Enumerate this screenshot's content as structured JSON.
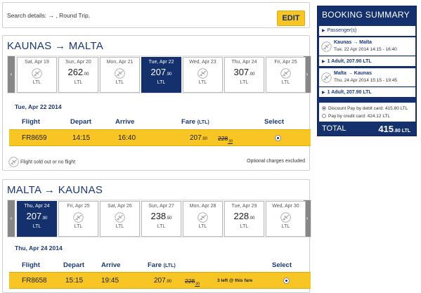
{
  "search": {
    "label": "Search details: → , Round Trip,",
    "edit": "EDIT"
  },
  "outbound": {
    "title": "KAUNAS → MALTA",
    "days": [
      {
        "date": "Sat, Apr 19",
        "price": "",
        "dec": "",
        "currency": "LTL",
        "available": false
      },
      {
        "date": "Sun, Apr 20",
        "price": "262",
        "dec": ".00",
        "currency": "LTL",
        "available": true
      },
      {
        "date": "Mon, Apr 21",
        "price": "",
        "dec": "",
        "currency": "LTL",
        "available": false
      },
      {
        "date": "Tue, Apr 22",
        "price": "207",
        "dec": ".90",
        "currency": "LTL",
        "available": true,
        "selected": true
      },
      {
        "date": "Wed, Apr 23",
        "price": "",
        "dec": "",
        "currency": "LTL",
        "available": false
      },
      {
        "date": "Thu, Apr 24",
        "price": "307",
        "dec": ".00",
        "currency": "LTL",
        "available": true
      },
      {
        "date": "Fri, Apr 25",
        "price": "",
        "dec": "",
        "currency": "LTL",
        "available": false
      }
    ],
    "selected_date": "Tue, Apr 22 2014",
    "headers": {
      "flight": "Flight",
      "depart": "Depart",
      "arrive": "Arrive",
      "fare": "Fare",
      "fare_unit": "(LTL)",
      "select": "Select"
    },
    "row": {
      "flight": "FR8659",
      "depart": "14:15",
      "arrive": "16:40",
      "fare": "207",
      "fare_dec": ".90",
      "old": "228",
      "old_dec": ".00"
    }
  },
  "legend": {
    "soldout": "Flight sold out or no flight",
    "optional": "Optional charges excluded"
  },
  "return": {
    "title": "MALTA → KAUNAS",
    "days": [
      {
        "date": "Thu, Apr 24",
        "price": "207",
        "dec": ".90",
        "currency": "LTL",
        "available": true,
        "selected": true
      },
      {
        "date": "Fri, Apr 25",
        "price": "",
        "dec": "",
        "currency": "LTL",
        "available": false
      },
      {
        "date": "Sat, Apr 26",
        "price": "",
        "dec": "",
        "currency": "LTL",
        "available": false
      },
      {
        "date": "Sun, Apr 27",
        "price": "238",
        "dec": ".50",
        "currency": "LTL",
        "available": true
      },
      {
        "date": "Mon, Apr 28",
        "price": "",
        "dec": "",
        "currency": "LTL",
        "available": false
      },
      {
        "date": "Tue, Apr 29",
        "price": "228",
        "dec": ".00",
        "currency": "LTL",
        "available": true
      },
      {
        "date": "Wed, Apr 30",
        "price": "",
        "dec": "",
        "currency": "LTL",
        "available": false
      }
    ],
    "selected_date": "Thu, Apr 24 2014",
    "headers": {
      "flight": "Flight",
      "depart": "Depart",
      "arrive": "Arrive",
      "fare": "Fare",
      "fare_unit": "(LTL)",
      "select": "Select"
    },
    "row": {
      "flight": "FR8658",
      "depart": "15:15",
      "arrive": "19:45",
      "fare": "207",
      "fare_dec": ".90",
      "old": "228",
      "old_dec": ".00",
      "left": "3 left @ this fare"
    }
  },
  "summary": {
    "title": "BOOKING SUMMARY",
    "passengers": "Passenger(s)",
    "out_route": "Kaunas → Malta",
    "out_when": "Tue, 22 Apr 2014 14:15 - 16:40",
    "out_fare": "1 Adult, 207.90 LTL",
    "ret_route": "Malta → Kaunas",
    "ret_when": "Thu, 24 Apr 2014 15:15 - 19:45",
    "ret_fare": "1 Adult, 207.90 LTL",
    "pay_debit": "Discount Pay by debit card: 415.80 LTL",
    "pay_credit": "Pay by credit card: 424.12 LTL",
    "total_label": "TOTAL",
    "total": "415",
    "total_dec": ".80 LTL"
  },
  "colors": {
    "navy": "#14306d",
    "yellow": "#f8c624",
    "grey": "#878787"
  },
  "icons": [
    "plane-icon",
    "chevron-left-icon",
    "chevron-right-icon",
    "radio-icon"
  ]
}
